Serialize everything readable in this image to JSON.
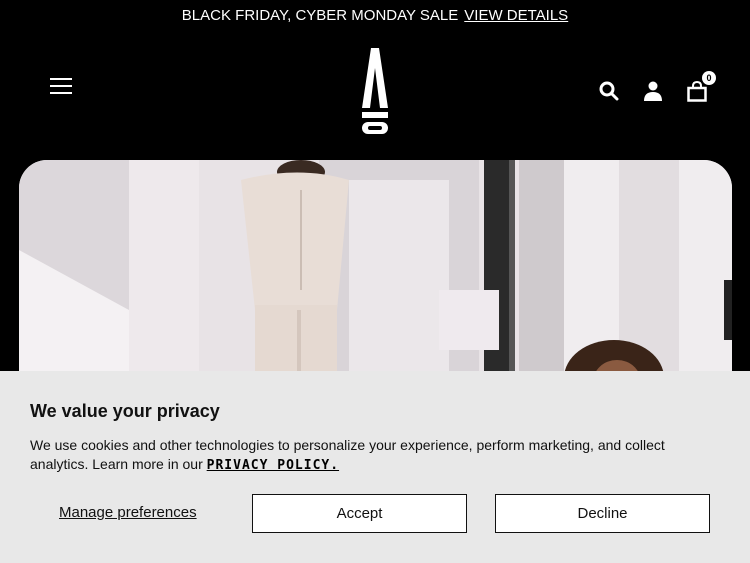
{
  "promo": {
    "text": "BLACK FRIDAY, CYBER MONDAY SALE",
    "link": "VIEW DETAILS"
  },
  "header": {
    "cart_count": "0",
    "icons": [
      "menu-icon",
      "brand-logo",
      "search-icon",
      "account-icon",
      "cart-icon"
    ]
  },
  "cookie": {
    "title": "We value your privacy",
    "text": "We use cookies and other technologies to personalize your experience, perform marketing, and collect analytics. Learn more in our",
    "policy_link": "PRIVACY POLICY.",
    "manage_label": "Manage preferences",
    "accept_label": "Accept",
    "decline_label": "Decline"
  },
  "colors": {
    "background": "#000000",
    "banner": "#e8e8e8",
    "text": "#111111"
  }
}
